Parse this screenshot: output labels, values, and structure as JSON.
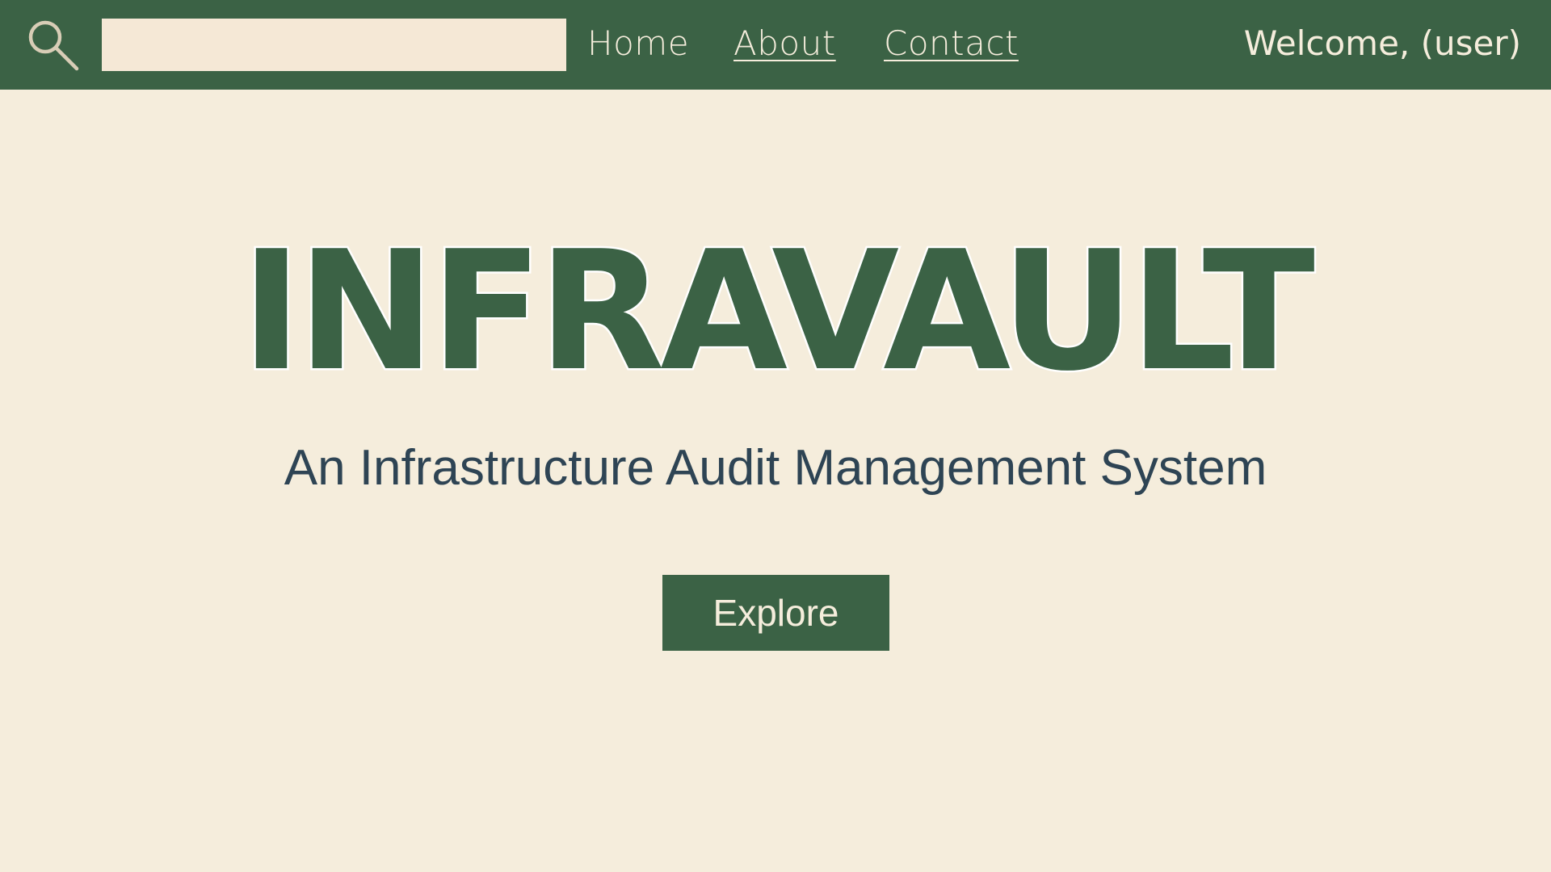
{
  "colors": {
    "brand_green": "#3B6245",
    "background_cream": "#F5EDDC",
    "search_field": "#F5E8D6",
    "subtitle_text": "#2E4454",
    "title_outline": "#FFFFFF"
  },
  "navbar": {
    "search": {
      "icon": "search-icon",
      "value": "",
      "placeholder": ""
    },
    "links": {
      "home": "Home",
      "about": "About",
      "contact": "Contact"
    },
    "welcome": "Welcome, (user)"
  },
  "hero": {
    "title": "INFRAVAULT",
    "subtitle": "An Infrastructure Audit Management System",
    "cta_label": "Explore"
  }
}
